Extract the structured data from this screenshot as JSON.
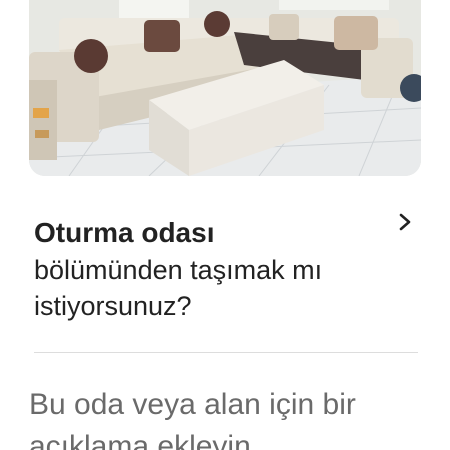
{
  "photo": {
    "icon": "room-photo"
  },
  "prompt": {
    "title": "Oturma odası",
    "subtitle": "bölümünden taşımak mı istiyorsunuz?",
    "chevron_icon": "chevron-right-icon"
  },
  "description": {
    "text": "Bu oda veya alan için bir açıklama ekleyin"
  },
  "colors": {
    "text_primary": "#222222",
    "text_secondary": "#6a6a6a",
    "divider": "#dddddd"
  }
}
